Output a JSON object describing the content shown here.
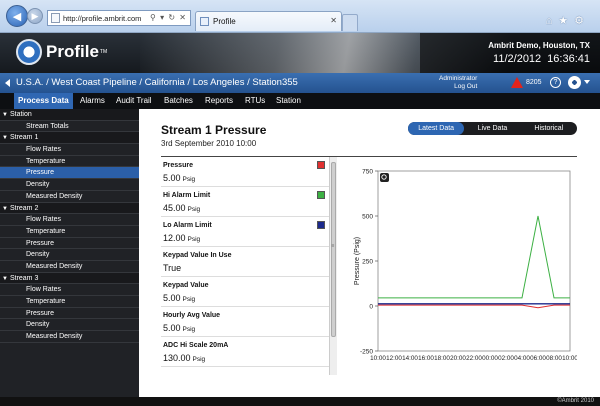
{
  "browser": {
    "url": "http://profile.ambrit.com",
    "tab_title": "Profile"
  },
  "header": {
    "logo_text": "Profile",
    "logo_tm": "TM",
    "org": "Ambrit Demo, Houston, TX",
    "date": "11/2/2012",
    "time": "16:36:41"
  },
  "breadcrumb": {
    "path": "U.S.A. / West Coast Pipeline / California / Los Angeles / Station355",
    "user_line1": "Administrator",
    "user_line2": "Log Out",
    "alarm_count": "8205"
  },
  "nav": [
    "Process Data",
    "Alarms",
    "Audit Trail",
    "Batches",
    "Reports",
    "RTUs",
    "Station"
  ],
  "sidebar": [
    {
      "label": "Station",
      "type": "group"
    },
    {
      "label": "Stream Totals",
      "type": "child"
    },
    {
      "label": "Stream 1",
      "type": "group"
    },
    {
      "label": "Flow Rates",
      "type": "child"
    },
    {
      "label": "Temperature",
      "type": "child"
    },
    {
      "label": "Pressure",
      "type": "child",
      "selected": true
    },
    {
      "label": "Density",
      "type": "child"
    },
    {
      "label": "Measured Density",
      "type": "child"
    },
    {
      "label": "Stream 2",
      "type": "group"
    },
    {
      "label": "Flow Rates",
      "type": "child"
    },
    {
      "label": "Temperature",
      "type": "child"
    },
    {
      "label": "Pressure",
      "type": "child"
    },
    {
      "label": "Density",
      "type": "child"
    },
    {
      "label": "Measured Density",
      "type": "child"
    },
    {
      "label": "Stream 3",
      "type": "group"
    },
    {
      "label": "Flow Rates",
      "type": "child"
    },
    {
      "label": "Temperature",
      "type": "child"
    },
    {
      "label": "Pressure",
      "type": "child"
    },
    {
      "label": "Density",
      "type": "child"
    },
    {
      "label": "Measured Density",
      "type": "child"
    }
  ],
  "main": {
    "title": "Stream 1 Pressure",
    "subtitle": "3rd September 2010 10:00",
    "toggle": [
      "Latest Data",
      "Live Data",
      "Historical"
    ],
    "toggle_active": 0
  },
  "params": [
    {
      "label": "Pressure",
      "value": "5.00",
      "unit": "Psig",
      "swatch": "#e03030"
    },
    {
      "label": "Hi Alarm Limit",
      "value": "45.00",
      "unit": "Psig",
      "swatch": "#3cb043"
    },
    {
      "label": "Lo Alarm Limit",
      "value": "12.00",
      "unit": "Psig",
      "swatch": "#1c2a8c"
    },
    {
      "label": "Keypad Value In Use",
      "value": "True",
      "unit": ""
    },
    {
      "label": "Keypad Value",
      "value": "5.00",
      "unit": "Psig"
    },
    {
      "label": "Hourly Avg Value",
      "value": "5.00",
      "unit": "Psig"
    },
    {
      "label": "ADC Hi Scale 20mA",
      "value": "130.00",
      "unit": "Psig"
    }
  ],
  "chart_data": {
    "type": "line",
    "ylabel": "Pressure (Psig)",
    "ylim": [
      -250,
      750
    ],
    "yticks": [
      -250,
      0,
      250,
      500,
      750
    ],
    "categories": [
      "10:00",
      "12:00",
      "14:00",
      "16:00",
      "18:00",
      "20:00",
      "22:00",
      "00:00",
      "02:00",
      "04:00",
      "06:00",
      "08:00",
      "10:00"
    ],
    "series": [
      {
        "color": "#3cb043",
        "values": [
          45,
          45,
          45,
          45,
          45,
          45,
          45,
          45,
          45,
          45,
          500,
          45,
          45
        ]
      },
      {
        "color": "#e03030",
        "values": [
          5,
          5,
          5,
          5,
          5,
          5,
          5,
          5,
          5,
          5,
          -10,
          5,
          5
        ]
      },
      {
        "color": "#1c2a8c",
        "values": [
          12,
          12,
          12,
          12,
          12,
          12,
          12,
          12,
          12,
          12,
          12,
          12,
          12
        ]
      }
    ],
    "grid": false
  },
  "footer": "©Ambrit 2010",
  "colors": {
    "accent": "#2f67b3",
    "nav_bg": "#0d0f12",
    "sidebar_bg": "#202226"
  }
}
